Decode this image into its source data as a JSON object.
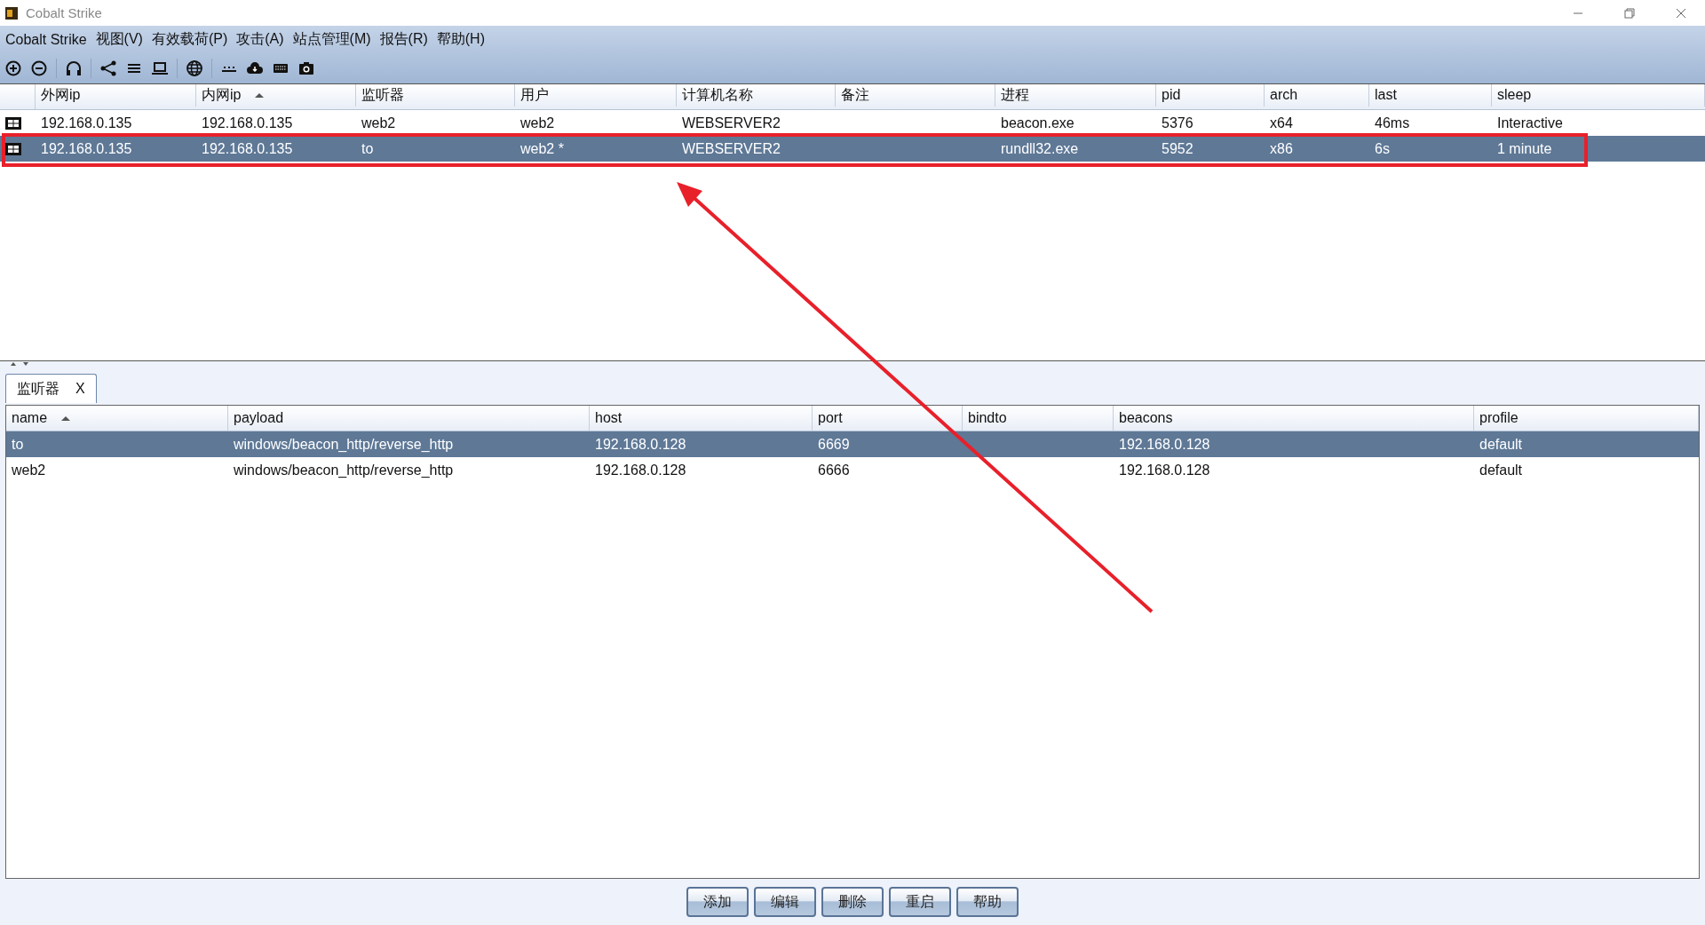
{
  "window": {
    "title": "Cobalt Strike"
  },
  "menu": [
    "Cobalt Strike",
    "视图(V)",
    "有效载荷(P)",
    "攻击(A)",
    "站点管理(M)",
    "报告(R)",
    "帮助(H)"
  ],
  "sessions": {
    "columns": [
      {
        "label": "外网ip",
        "sorted": false
      },
      {
        "label": "内网ip",
        "sorted": true
      },
      {
        "label": "监听器",
        "sorted": false
      },
      {
        "label": "用户",
        "sorted": false
      },
      {
        "label": "计算机名称",
        "sorted": false
      },
      {
        "label": "备注",
        "sorted": false
      },
      {
        "label": "进程",
        "sorted": false
      },
      {
        "label": "pid",
        "sorted": false
      },
      {
        "label": "arch",
        "sorted": false
      },
      {
        "label": "last",
        "sorted": false
      },
      {
        "label": "sleep",
        "sorted": false
      }
    ],
    "rows": [
      {
        "selected": false,
        "cells": [
          "192.168.0.135",
          "192.168.0.135",
          "web2",
          "web2",
          "WEBSERVER2",
          "",
          "beacon.exe",
          "5376",
          "x64",
          "46ms",
          "Interactive"
        ]
      },
      {
        "selected": true,
        "cells": [
          "192.168.0.135",
          "192.168.0.135",
          "to",
          "web2 *",
          "WEBSERVER2",
          "",
          "rundll32.exe",
          "5952",
          "x86",
          "6s",
          "1 minute"
        ]
      }
    ]
  },
  "tab": {
    "label": "监听器",
    "close": "X"
  },
  "listeners": {
    "columns": [
      {
        "label": "name",
        "sorted": true
      },
      {
        "label": "payload",
        "sorted": false
      },
      {
        "label": "host",
        "sorted": false
      },
      {
        "label": "port",
        "sorted": false
      },
      {
        "label": "bindto",
        "sorted": false
      },
      {
        "label": "beacons",
        "sorted": false
      },
      {
        "label": "profile",
        "sorted": false
      }
    ],
    "rows": [
      {
        "selected": true,
        "cells": [
          "to",
          "windows/beacon_http/reverse_http",
          "192.168.0.128",
          "6669",
          "",
          "192.168.0.128",
          "default"
        ]
      },
      {
        "selected": false,
        "cells": [
          "web2",
          "windows/beacon_http/reverse_http",
          "192.168.0.128",
          "6666",
          "",
          "192.168.0.128",
          "default"
        ]
      }
    ]
  },
  "buttons": [
    "添加",
    "编辑",
    "删除",
    "重启",
    "帮助"
  ]
}
